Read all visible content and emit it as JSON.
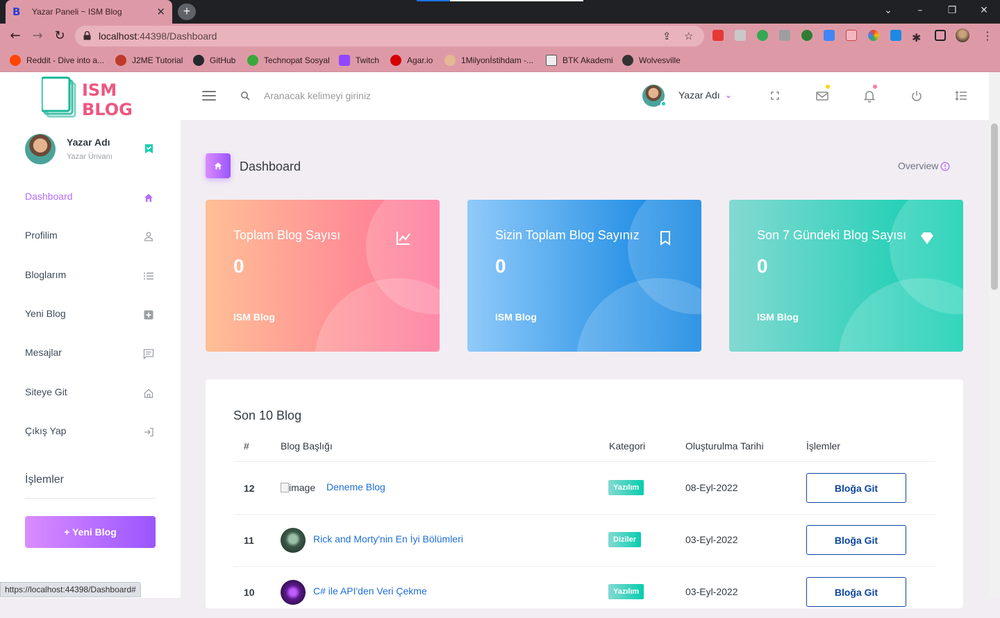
{
  "browser": {
    "tab_title": "Yazar Paneli ~ ISM Blog",
    "tab_favicon": "B",
    "url_host": "localhost",
    "url_rest": ":44398/Dashboard",
    "status_url": "https://localhost:44398/Dashboard#",
    "bookmarks": [
      {
        "label": "Reddit - Dive into a...",
        "color": "#ff4500"
      },
      {
        "label": "J2ME Tutorial",
        "color": "#c0392b"
      },
      {
        "label": "GitHub",
        "color": "#24292e"
      },
      {
        "label": "Technopat Sosyal",
        "color": "#3aa83a"
      },
      {
        "label": "Twitch",
        "color": "#9146ff"
      },
      {
        "label": "Agar.io",
        "color": "#d40000"
      },
      {
        "label": "1Milyonİstihdam -...",
        "color": "#c47a3a"
      },
      {
        "label": "BTK Akademi",
        "color": "#555555"
      },
      {
        "label": "Wolvesville",
        "color": "#333333"
      }
    ]
  },
  "navbar": {
    "logo_line1": "ISM",
    "logo_line2": "BLOG",
    "search_placeholder": "Aranacak kelimeyi giriniz",
    "user_name": "Yazar Adı"
  },
  "sidebar": {
    "profile_name": "Yazar Adı",
    "profile_title": "Yazar Ünvanı",
    "items": [
      {
        "label": "Dashboard",
        "icon": "home-icon"
      },
      {
        "label": "Profilim",
        "icon": "user-icon"
      },
      {
        "label": "Bloglarım",
        "icon": "list-icon"
      },
      {
        "label": "Yeni Blog",
        "icon": "plus-box-icon"
      },
      {
        "label": "Mesajlar",
        "icon": "message-icon"
      },
      {
        "label": "Siteye Git",
        "icon": "house-icon"
      },
      {
        "label": "Çıkış Yap",
        "icon": "logout-icon"
      }
    ],
    "section_title": "İşlemler",
    "new_blog_button": "+ Yeni Blog"
  },
  "page": {
    "title": "Dashboard",
    "overview": "Overview"
  },
  "cards": [
    {
      "title": "Toplam Blog Sayısı",
      "value": "0",
      "subtitle": "ISM Blog",
      "icon": "chart-line-icon"
    },
    {
      "title": "Sizin Toplam Blog Sayınız",
      "value": "0",
      "subtitle": "ISM Blog",
      "icon": "bookmark-icon"
    },
    {
      "title": "Son 7 Gündeki Blog Sayısı",
      "value": "0",
      "subtitle": "ISM Blog",
      "icon": "diamond-icon"
    }
  ],
  "table": {
    "title": "Son 10 Blog",
    "headers": [
      "#",
      "Blog Başlığı",
      "Kategori",
      "Oluşturulma Tarihi",
      "İşlemler"
    ],
    "rows": [
      {
        "id": "12",
        "image_alt": "image",
        "title": "Deneme Blog",
        "category": "Yazılım",
        "date": "08-Eyl-2022",
        "action": "Bloğa Git"
      },
      {
        "id": "11",
        "title": "Rick and Morty'nin En İyi Bölümleri",
        "category": "Diziler",
        "date": "03-Eyl-2022",
        "action": "Bloğa Git"
      },
      {
        "id": "10",
        "title": "C# ile API'den Veri Çekme",
        "category": "Yazılım",
        "date": "03-Eyl-2022",
        "action": "Bloğa Git"
      }
    ]
  },
  "colors": {
    "accent": "#b66dff",
    "card1": [
      "#ffbf96",
      "#fe7096"
    ],
    "card2": [
      "#90caf9",
      "#047edf"
    ],
    "card3": [
      "#84d9d2",
      "#07cdae"
    ]
  }
}
